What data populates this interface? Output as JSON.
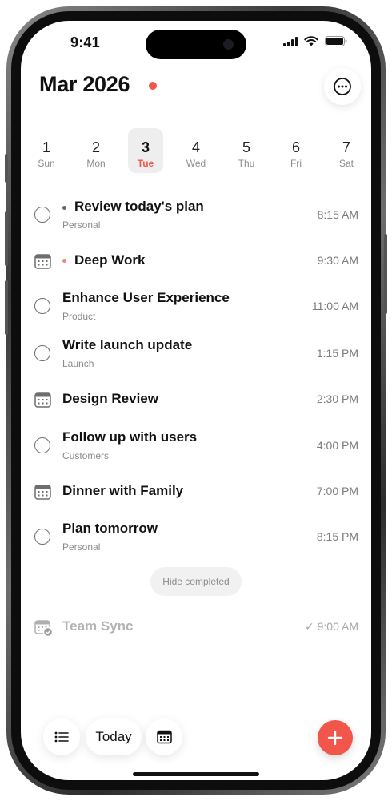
{
  "colors": {
    "accent": "#f2564a",
    "text_primary": "#111111",
    "text_secondary": "#8a8a8a",
    "selected_day_bg": "#eeeeee",
    "personal_dot": "#666666",
    "deep_work_dot": "#ec8a6a"
  },
  "status_bar": {
    "time": "9:41",
    "icons": [
      "cellular-signal-icon",
      "wifi-icon",
      "battery-icon"
    ]
  },
  "header": {
    "title": "Mar 2026",
    "more_icon": "ellipsis-circle-icon"
  },
  "week": [
    {
      "num": "1",
      "name": "Sun",
      "selected": false
    },
    {
      "num": "2",
      "name": "Mon",
      "selected": false
    },
    {
      "num": "3",
      "name": "Tue",
      "selected": true
    },
    {
      "num": "4",
      "name": "Wed",
      "selected": false
    },
    {
      "num": "5",
      "name": "Thu",
      "selected": false
    },
    {
      "num": "6",
      "name": "Fri",
      "selected": false
    },
    {
      "num": "7",
      "name": "Sat",
      "selected": false
    }
  ],
  "tasks": [
    {
      "title": "Review today's plan",
      "subtitle": "Personal",
      "time": "8:15 AM",
      "kind": "todo",
      "bullet_color": "#666666"
    },
    {
      "title": "Deep Work",
      "subtitle": "",
      "time": "9:30 AM",
      "kind": "event",
      "bullet_color": "#ec8a6a"
    },
    {
      "title": "Enhance User Experience",
      "subtitle": "Product",
      "time": "11:00 AM",
      "kind": "todo"
    },
    {
      "title": "Write launch update",
      "subtitle": "Launch",
      "time": "1:15 PM",
      "kind": "todo"
    },
    {
      "title": "Design Review",
      "subtitle": "",
      "time": "2:30 PM",
      "kind": "event"
    },
    {
      "title": "Follow up with users",
      "subtitle": "Customers",
      "time": "4:00 PM",
      "kind": "todo"
    },
    {
      "title": "Dinner with Family",
      "subtitle": "",
      "time": "7:00 PM",
      "kind": "event"
    },
    {
      "title": "Plan tomorrow",
      "subtitle": "Personal",
      "time": "8:15 PM",
      "kind": "todo"
    }
  ],
  "hide_completed_label": "Hide completed",
  "completed": {
    "title": "Team Sync",
    "time": "✓ 9:00 AM",
    "icon": "calendar-check-icon"
  },
  "bottom_bar": {
    "list_icon": "list-icon",
    "today_label": "Today",
    "calendar_icon": "calendar-icon",
    "add_icon": "plus-icon"
  }
}
